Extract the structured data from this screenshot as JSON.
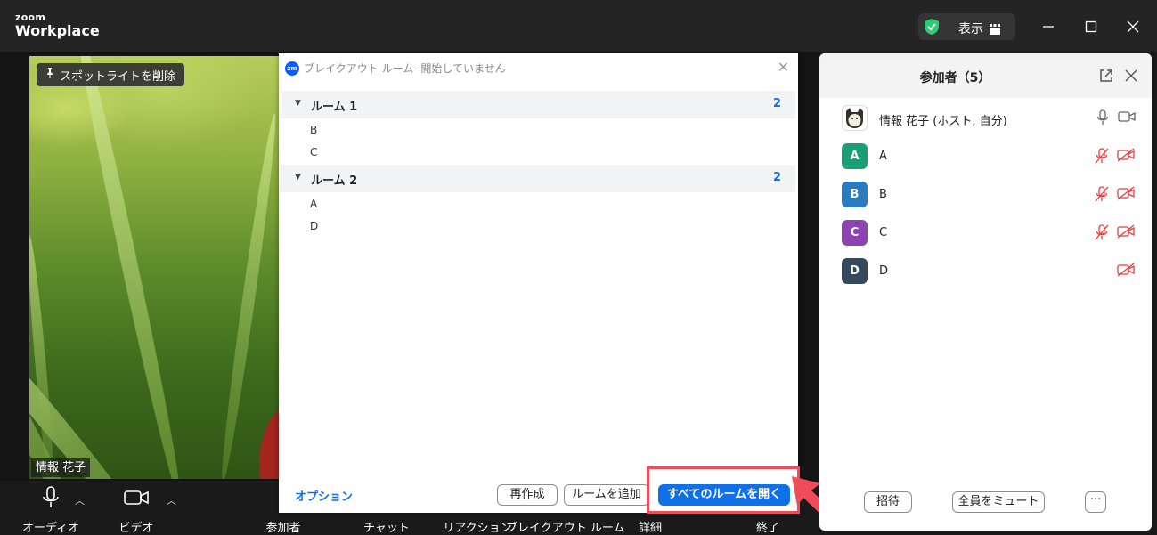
{
  "app": {
    "logo_line1": "zoom",
    "logo_line2": "Workplace"
  },
  "titlebar": {
    "view_label": "表示"
  },
  "video": {
    "spotlight_button": "スポットライトを削除",
    "participant_name": "情報 花子"
  },
  "toolbar": {
    "items": [
      {
        "label": "オーディオ",
        "icon": "microphone-icon"
      },
      {
        "label": "ビデオ",
        "icon": "video-camera-icon"
      },
      {
        "label": "参加者",
        "icon": "participants-icon"
      },
      {
        "label": "チャット",
        "icon": "chat-icon"
      },
      {
        "label": "リアクション",
        "icon": "reaction-icon"
      },
      {
        "label": "ブレイクアウト ルーム",
        "icon": "breakout-icon"
      },
      {
        "label": "詳細",
        "icon": "more-icon"
      },
      {
        "label": "終了",
        "icon": "end-icon"
      }
    ]
  },
  "breakout_dialog": {
    "title": "ブレイクアウト ルーム- 開始していません",
    "rooms": [
      {
        "name": "ルーム 1",
        "count": "2",
        "members": [
          "B",
          "C"
        ]
      },
      {
        "name": "ルーム 2",
        "count": "2",
        "members": [
          "A",
          "D"
        ]
      }
    ],
    "options_link": "オプション",
    "recreate_button": "再作成",
    "add_room_button": "ルームを追加",
    "open_all_button": "すべてのルームを開く"
  },
  "participants_panel": {
    "title": "参加者（5）",
    "participants": [
      {
        "name": "情報 花子 (ホスト, 自分)",
        "initial": "",
        "color": "#ffffff"
      },
      {
        "name": "A",
        "initial": "A",
        "color": "#1a9e78"
      },
      {
        "name": "B",
        "initial": "B",
        "color": "#2b7bbf"
      },
      {
        "name": "C",
        "initial": "C",
        "color": "#8c44b0"
      },
      {
        "name": "D",
        "initial": "D",
        "color": "#34495e"
      }
    ],
    "invite_button": "招待",
    "mute_all_button": "全員をミュート",
    "more_button": "···"
  },
  "colors": {
    "accent": "#0e71eb",
    "highlight": "#ee4c58",
    "muted": "#e53e3e",
    "secure": "#2ecc71"
  }
}
